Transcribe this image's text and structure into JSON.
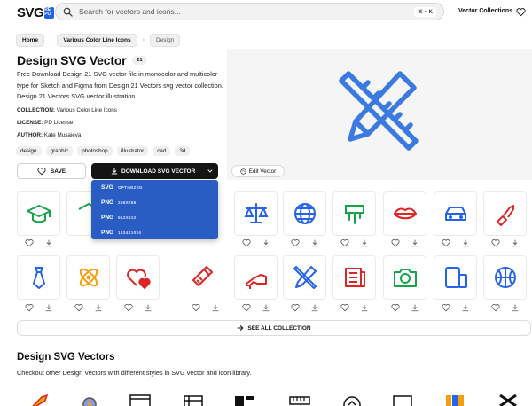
{
  "header": {
    "logo_text": "SVG",
    "logo_badge": "RE PO",
    "search_placeholder": "Search for vectors and icons...",
    "shortcut": "⌘ + K",
    "vector_collections": "Vector Collections"
  },
  "breadcrumb": [
    "Home",
    "Various Color Line Icons",
    "Design"
  ],
  "page": {
    "title": "Design SVG Vector",
    "count": "21",
    "description": "Free Download Design 21 SVG vector file in monocolor and multicolor type for Sketch and Figma from Design 21 Vectors svg vector collection. Design 21 Vectors SVG vector illustration",
    "collection_label": "COLLECTION:",
    "collection_value": "Various Color Line Icons",
    "license_label": "LICENSE:",
    "license_value": "PD License",
    "author_label": "AUTHOR:",
    "author_value": "Kate Musaieva",
    "tags": [
      "design",
      "graphic",
      "photoshop",
      "illustrator",
      "cad",
      "3d"
    ]
  },
  "actions": {
    "save": "SAVE",
    "download": "DOWNLOAD SVG VECTOR",
    "edit": "Edit Vector"
  },
  "download_menu": [
    {
      "format": "SVG",
      "size": "OPTIMIZED"
    },
    {
      "format": "PNG",
      "size": "256X256"
    },
    {
      "format": "PNG",
      "size": "512X512"
    },
    {
      "format": "PNG",
      "size": "1024X1024"
    }
  ],
  "icons_row1": [
    "graduation-cap-icon",
    "cube-icon",
    "magic-icon",
    "wine-icon",
    "scales-icon",
    "globe-icon",
    "drip-icon",
    "lips-icon",
    "car-icon",
    "lipstick-icon"
  ],
  "icons_row2": [
    "tie-icon",
    "atom-icon",
    "hearts-icon",
    "baby-bottle-icon",
    "high-heel-icon",
    "ruler-pencil-icon",
    "newspaper-icon",
    "camera-icon",
    "devices-icon",
    "ball-icon"
  ],
  "see_all": "SEE ALL COLLECTION",
  "section": {
    "title": "Design SVG Vectors",
    "subtitle": "Checkout other Design Vectors with different styles in SVG vector and icon library."
  },
  "colors": {
    "accent": "#2563eb",
    "menu_bg": "#2a5dc3",
    "green": "#16a34a",
    "red": "#dc2626",
    "orange": "#f59e0b"
  }
}
